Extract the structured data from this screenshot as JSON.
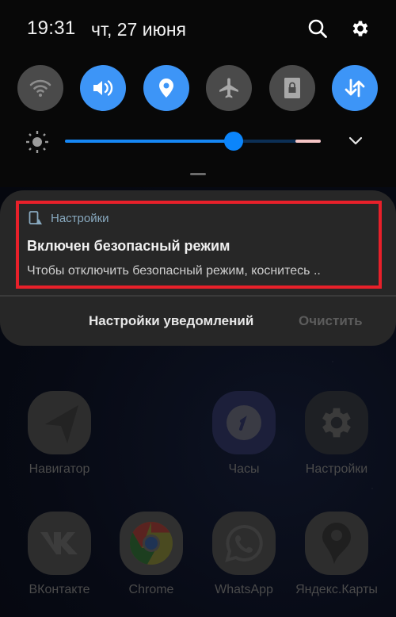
{
  "status_bar": {
    "time": "19:31",
    "date": "чт, 27 июня",
    "icons": [
      "search-icon",
      "gear-icon"
    ]
  },
  "quick_toggles": [
    {
      "name": "wifi",
      "icon": "wifi-icon",
      "state": "off"
    },
    {
      "name": "sound",
      "icon": "speaker-icon",
      "state": "on"
    },
    {
      "name": "location",
      "icon": "location-pin-icon",
      "state": "on"
    },
    {
      "name": "airplane-mode",
      "icon": "airplane-icon",
      "state": "off"
    },
    {
      "name": "screen-lock-rotation",
      "icon": "lock-icon",
      "state": "off"
    },
    {
      "name": "mobile-data",
      "icon": "data-arrows-icon",
      "state": "on"
    }
  ],
  "brightness": {
    "level": 0.66,
    "warning_from": 0.9,
    "icon": "sun-icon"
  },
  "notification": {
    "app_icon": "safe-mode-phone-icon",
    "app_name": "Настройки",
    "title": "Включен безопасный режим",
    "text": "Чтобы отключить безопасный режим, коснитесь ..",
    "highlight_color": "#e8202a"
  },
  "notification_actions": {
    "settings_label": "Настройки уведомлений",
    "clear_label": "Очистить"
  },
  "apps": [
    {
      "label": "Навигатор",
      "icon": "navigator-icon"
    },
    {
      "label": "Часы",
      "icon": "clock-icon"
    },
    {
      "label": "Настройки",
      "icon": "settings-gear-icon"
    },
    {
      "label": "ВКонтакте",
      "icon": "vk-icon"
    },
    {
      "label": "Chrome",
      "icon": "chrome-icon"
    },
    {
      "label": "WhatsApp",
      "icon": "whatsapp-icon"
    },
    {
      "label": "Яндекс.Карты",
      "icon": "yandex-maps-icon"
    }
  ],
  "colors": {
    "accent": "#3d95f7",
    "toggle_off": "#4a4a4a",
    "slider_fill": "#1687f5",
    "card_bg": "#272727"
  }
}
